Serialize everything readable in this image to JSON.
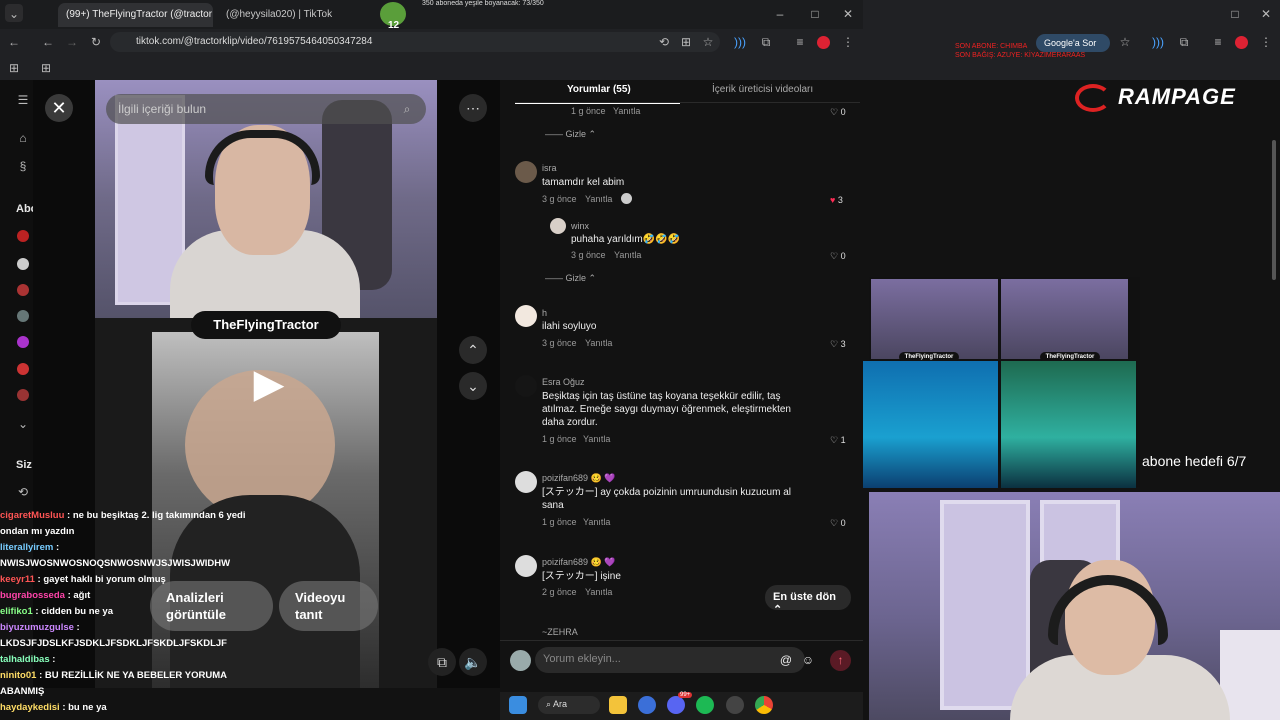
{
  "browser": {
    "tabs": [
      "(99+) TheFlyingTractor (@tractor",
      "(@heyysila020) | TikTok"
    ],
    "top_caption": "350 aboneda yeşile boyanacak: 73/350",
    "url": "tiktok.com/@tractorklip/video/7619575464050347284",
    "google_sor": "Google'a Sor"
  },
  "stream_overlay": {
    "red_lines": [
      "SON ABONE: CHIMBA",
      "SON BAĞIŞ: AZUYE: KİYAZIMERARAAS"
    ],
    "brand": "RAMPAGE",
    "sub_goal": "abone hedefi 6/7",
    "thumb_tags": [
      "TheFlyingTractor",
      "TheFlyingTractor"
    ],
    "badge_number": "12"
  },
  "tiktok": {
    "search_placeholder": "İlgili içeriği bulun",
    "channel_tag": "TheFlyingTractor",
    "analytics_btn": "Analizleri görüntüle",
    "promote_btn": "Videoyu tanıt",
    "tabs": {
      "comments": "Yorumlar (55)",
      "creator": "İçerik üreticisi videoları"
    },
    "back_top": "En üste dön",
    "comment_placeholder": "Yorum ekleyin...",
    "comments": [
      {
        "top_meta": "1 g önce",
        "reply": "Yanıtla",
        "likes": "0"
      },
      {
        "gizle": "Gizle"
      },
      {
        "name": "isra",
        "text": "tamamdır kel abim",
        "meta": "3 g önce",
        "reply": "Yanıtla",
        "likes": "3"
      },
      {
        "name": "winx",
        "text": "puhaha yarıldım🤣🤣🤣",
        "meta": "3 g önce",
        "reply": "Yanıtla",
        "likes": "0"
      },
      {
        "gizle": "Gizle"
      },
      {
        "name": "h",
        "text": "ilahi soyluyo",
        "meta": "3 g önce",
        "reply": "Yanıtla",
        "likes": "3"
      },
      {
        "name": "Esra Oğuz",
        "text": "Beşiktaş için taş üstüne taş koyana teşekkür edilir, taş atılmaz. Emeğe saygı duymayı öğrenmek, eleştirmekten daha zordur.",
        "meta": "1 g önce",
        "reply": "Yanıtla",
        "likes": "1"
      },
      {
        "name": "poizifan689 🥴 💜",
        "text": "[ステッカー] ay çokda poizinin umruundusin kuzucum al sana",
        "meta": "1 g önce",
        "reply": "Yanıtla",
        "likes": "0"
      },
      {
        "name": "poizifan689 🥴 💜",
        "text": "[ステッカー] işine",
        "meta": "2 g önce",
        "reply": "Yanıtla"
      },
      {
        "name": "~ZEHRA"
      }
    ]
  },
  "chat": [
    {
      "user": "cigaretMusluu",
      "msg": ": ne bu beşiktaş 2. lig takımından 6 yedi ondan mı yazdın"
    },
    {
      "user": "literallyirem",
      "msg": ": NWISJWOSNWOSNOQSNWOSNWJSJWISJWIDHW"
    },
    {
      "user": "keeyr11",
      "msg": ": gayet haklı bi yorum olmuş"
    },
    {
      "user": "bugrabosseda",
      "msg": ": ağıt"
    },
    {
      "user": "elifiko1",
      "msg": ": cidden bu ne ya"
    },
    {
      "user": "biyuzumuzgulse",
      "msg": ": LKDSJFJDSLKFJSDKLJFSDKLJFSKDLJFSKDLJF"
    },
    {
      "user": "talhaldibas",
      "msg": ":"
    },
    {
      "user": "ninito01",
      "msg": ": BU REZİLLİK NE YA BEBELER YORUMA ABANMIŞ"
    },
    {
      "user": "haydaykedisi",
      "msg": ": bu ne ya"
    }
  ],
  "sidebar": {
    "abo": "Abo",
    "siz": "Siz"
  },
  "taskbar": {
    "search": "Ara",
    "badge": "99+"
  },
  "colors": {
    "accent_red": "#fe2c55",
    "chat_user": "#ff5555"
  }
}
